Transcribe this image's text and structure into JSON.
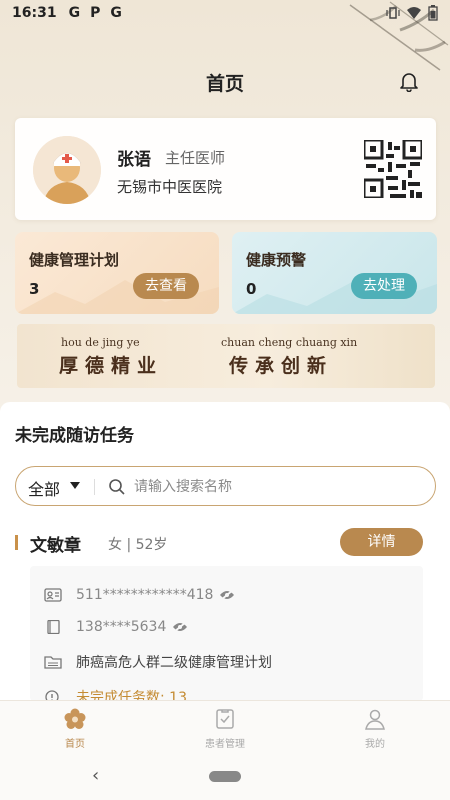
{
  "status": {
    "time": "16:31",
    "apps": [
      "G",
      "P",
      "G"
    ]
  },
  "header": {
    "title": "首页"
  },
  "doctor": {
    "name": "张语",
    "title": "主任医师",
    "hospital": "无锡市中医医院"
  },
  "tiles": {
    "plan": {
      "title": "健康管理计划",
      "count": "3",
      "button": "去查看"
    },
    "warning": {
      "title": "健康预警",
      "count": "0",
      "button": "去处理"
    }
  },
  "motto": {
    "pinyin_left": "hou  de  jing  ye",
    "chars_left": "厚德精业",
    "pinyin_right": "chuan cheng chuang xin",
    "chars_right": "传承创新"
  },
  "tasks": {
    "section_title": "未完成随访任务",
    "filter": "全部",
    "search_placeholder": "请输入搜索名称"
  },
  "patient": {
    "name": "文敏章",
    "meta": "女 | 52岁",
    "detail_button": "详情",
    "id_number": "511************418",
    "phone": "138****5634",
    "plan": "肺癌高危人群二级健康管理计划",
    "unfinished_tasks": "未完成任务数: 13"
  },
  "tabbar": [
    {
      "label": "首页",
      "active": true
    },
    {
      "label": "患者管理",
      "active": false
    },
    {
      "label": "我的",
      "active": false
    }
  ],
  "colors": {
    "accent": "#b9894f",
    "teal": "#4fb0b8",
    "warning_text": "#c48b32"
  }
}
